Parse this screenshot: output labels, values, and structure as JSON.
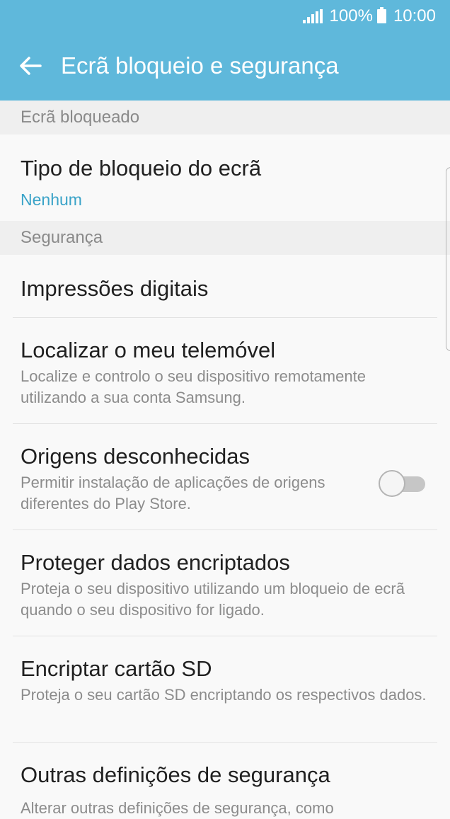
{
  "status_bar": {
    "battery_percent": "100%",
    "time": "10:00"
  },
  "app_bar": {
    "title": "Ecrã bloqueio e segurança"
  },
  "sections": {
    "lock_screen": {
      "header": "Ecrã bloqueado",
      "screen_lock_type": {
        "title": "Tipo de bloqueio do ecrã",
        "value": "Nenhum"
      }
    },
    "security": {
      "header": "Segurança",
      "fingerprints": {
        "title": "Impressões digitais"
      },
      "find_my_mobile": {
        "title": "Localizar o meu telemóvel",
        "subtitle": "Localize e controlo o seu dispositivo remotamente utilizando a sua conta Samsung."
      },
      "unknown_sources": {
        "title": "Origens desconhecidas",
        "subtitle": "Permitir instalação de aplicações de origens diferentes do Play Store.",
        "enabled": false
      },
      "secure_startup": {
        "title": "Proteger dados encriptados",
        "subtitle": "Proteja o seu dispositivo utilizando um bloqueio de ecrã quando o seu dispositivo for ligado."
      },
      "encrypt_sd": {
        "title": "Encriptar cartão SD",
        "subtitle": "Proteja o seu cartão SD encriptando os respectivos dados."
      },
      "other_security": {
        "title": "Outras definições de segurança",
        "subtitle": "Alterar outras definições de segurança, como"
      }
    }
  },
  "colors": {
    "app_bar": "#5fb8db",
    "accent": "#3aa3c8",
    "background": "#f9f9f9",
    "section_header_bg": "#efefef"
  },
  "icons": {
    "back": "back-arrow-icon",
    "signal": "signal-icon",
    "battery": "battery-icon"
  }
}
